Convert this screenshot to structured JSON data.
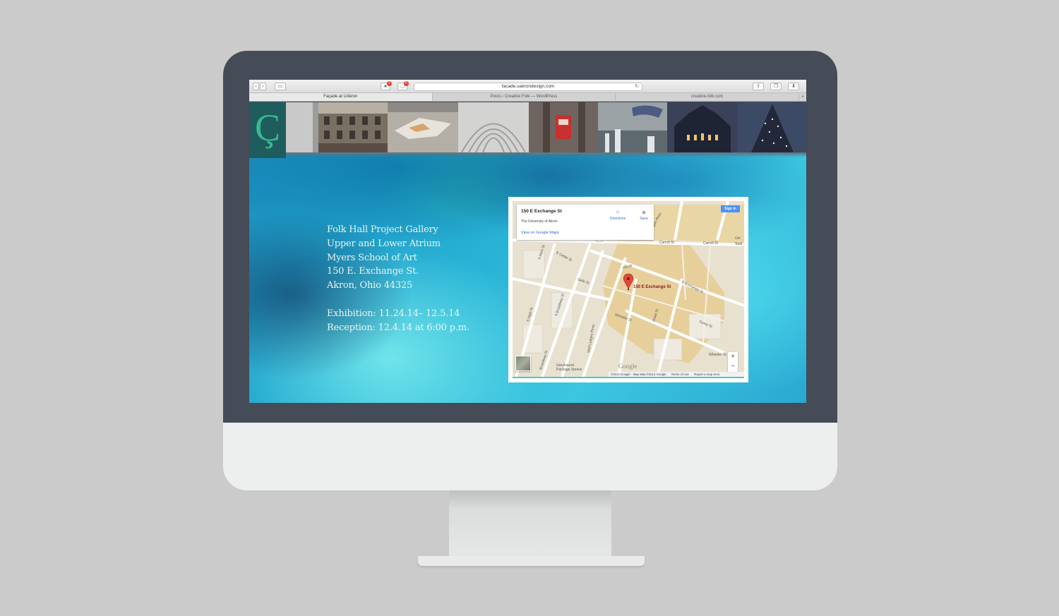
{
  "browser": {
    "url": "facade.uakrondesign.com",
    "badges": [
      "3",
      "5"
    ],
    "tabs": [
      "Façade at UAkron",
      "Posts ‹ Creative Folk — WordPress",
      "creative-folk.com"
    ]
  },
  "site": {
    "logo_glyph": "Ç",
    "photos": [
      "building-facade",
      "paper-model",
      "white-arches",
      "red-mailbox",
      "jump-skyline",
      "night-church",
      "tower-lights"
    ]
  },
  "event": {
    "lines": [
      "Folk Hall Project Gallery",
      "Upper and Lower Atrium",
      "Myers School of Art",
      "150 E. Exchange St.",
      "Akron, Ohio 44325"
    ],
    "exhibition": "Exhibition: 11.24.14– 12.5.14",
    "reception": "Reception: 12.4.14 at 6:00 p.m."
  },
  "map": {
    "place_title": "150 E Exchange St",
    "place_subtitle": "The University of Akron",
    "view_link": "View on Google Maps",
    "directions_label": "Directions",
    "save_label": "Save",
    "signin_label": "Sign in",
    "marker_label": "150 E Exchange St",
    "zoom_in": "+",
    "zoom_out": "−",
    "google": "Google",
    "attribution": [
      "©2014 Google · Map data ©2014 Google",
      "Terms of Use",
      "Report a map error"
    ],
    "streets": {
      "carroll1": "Carroll St",
      "carroll2": "Carroll St",
      "exchange": "E Exchange St",
      "arc": "Arc Dr",
      "cedar": "E Cedar St",
      "selle": "Selle St",
      "wheeler": "Wheeler St",
      "grant": "Grant St",
      "torrey": "Torrey St",
      "wheeler2": "Wheeler St",
      "s_main": "S Main St",
      "s_high": "S High St",
      "s_broadway": "S Broadway St",
      "wolf": "Wolf Ledges Pkwy",
      "broadway2": "Broadway St",
      "greyhound": "Greyhound",
      "package": "Package Xpress",
      "ledges": "Ledges Pkwy",
      "uni": "Uni",
      "stud": "Stud",
      "route": "261"
    },
    "colors": {
      "campus": "#e6cf9b",
      "road": "#ffffff",
      "land": "#e8e1d0",
      "marker": "#e0463b"
    }
  },
  "colors": {
    "bezel": "#454b57",
    "logo_bg": "#1f5c5d",
    "logo_fg": "#38b98f",
    "text": "#e9f4ef"
  }
}
